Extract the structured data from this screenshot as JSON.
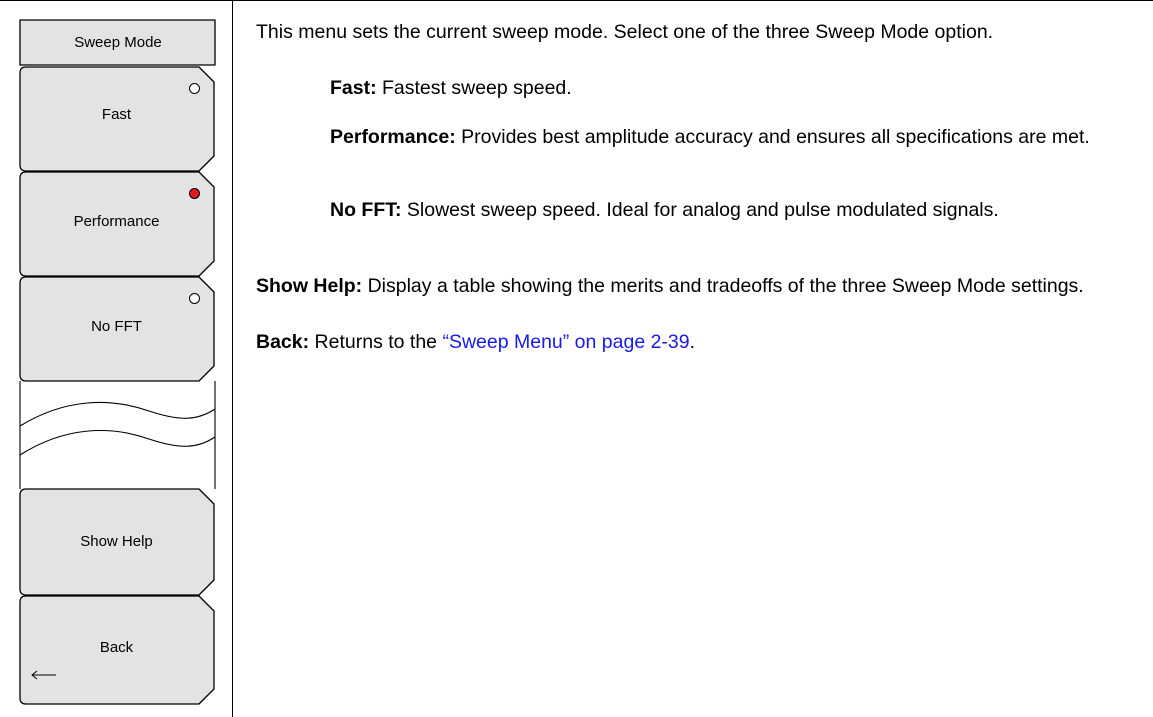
{
  "menu": {
    "title": "Sweep Mode",
    "keys": [
      {
        "label": "Fast",
        "selected": false
      },
      {
        "label": "Performance",
        "selected": true
      },
      {
        "label": "No FFT",
        "selected": false
      },
      {
        "label": "Show Help"
      },
      {
        "label": "Back"
      }
    ],
    "indicator_color_selected": "#e11b1b",
    "back_icon": "left-arrow-icon"
  },
  "text": {
    "intro": "This menu sets the current sweep mode. Select one of the three Sweep Mode option.",
    "options": [
      {
        "term": "Fast:",
        "desc": " Fastest sweep speed."
      },
      {
        "term": "Performance:",
        "desc": " Provides best amplitude accuracy and ensures all specifications are met."
      },
      {
        "term": "No FFT:",
        "desc": " Slowest sweep speed. Ideal for analog and pulse modulated signals."
      }
    ],
    "show_help": {
      "term": "Show Help:",
      "desc": "  Display a table showing the merits and tradeoffs of the three Sweep Mode settings."
    },
    "back": {
      "term": "Back:",
      "desc_before": "  Returns to the ",
      "link": "“Sweep Menu” on page 2-39",
      "desc_after": "."
    },
    "link_color": "#1a1ae6"
  }
}
